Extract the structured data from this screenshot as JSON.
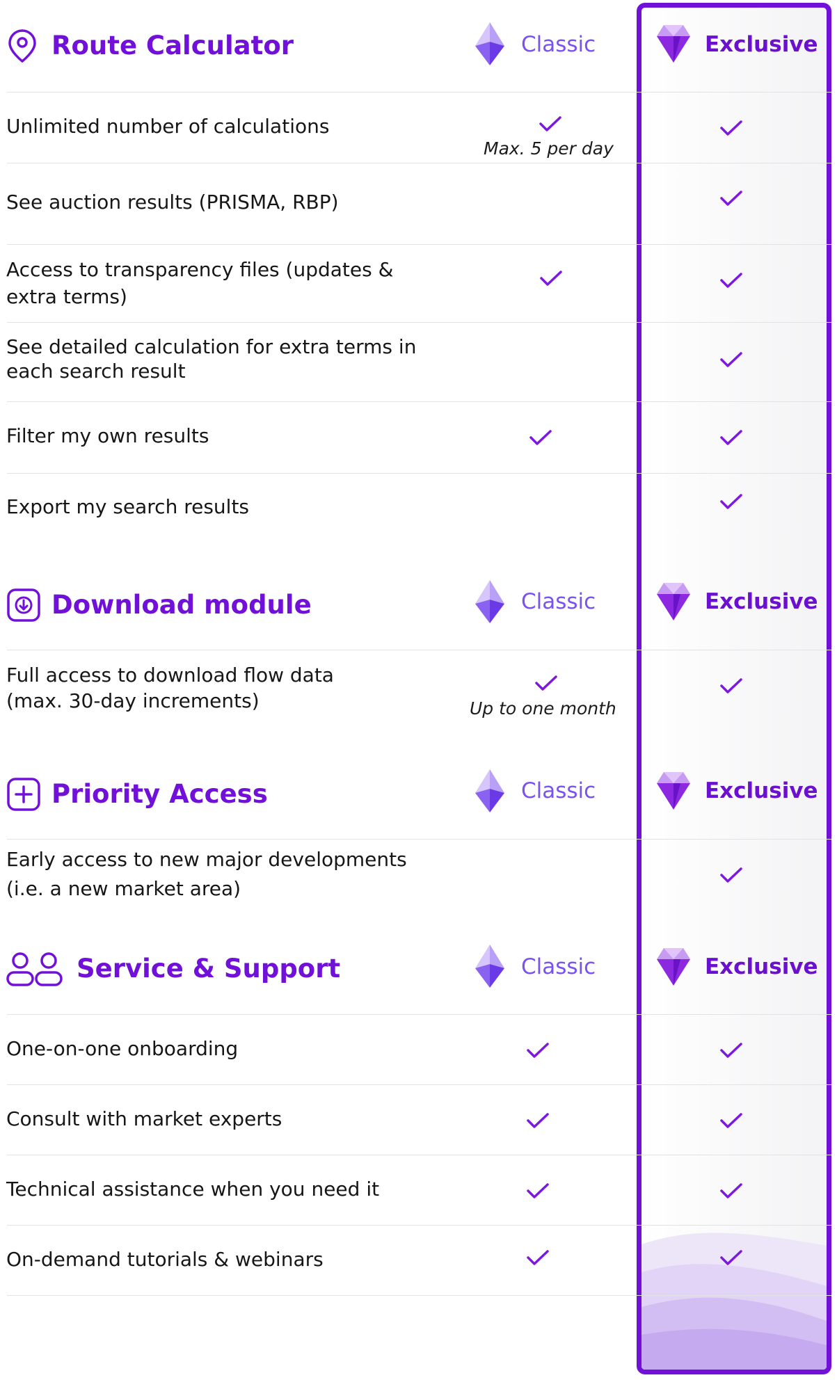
{
  "tier_labels": {
    "classic": "Classic",
    "exclusive": "Exclusive"
  },
  "colors": {
    "accent": "#7110d8",
    "classic": "#7a52f0",
    "check": "#7d18e0",
    "divider": "#e2e2e2"
  },
  "sections": [
    {
      "title": "Route Calculator",
      "icon": "location-pin-icon",
      "features": [
        {
          "label": "Unlimited number of calculations",
          "classic": true,
          "classic_note": "Max. 5 per day",
          "exclusive": true
        },
        {
          "label": "See auction results (PRISMA, RBP)",
          "classic": false,
          "exclusive": true
        },
        {
          "label_lines": [
            "Access to transparency files (updates &",
            "extra terms)"
          ],
          "classic": true,
          "exclusive": true
        },
        {
          "label_lines": [
            "See detailed calculation for extra terms in",
            "each search result"
          ],
          "classic": false,
          "exclusive": true
        },
        {
          "label": "Filter my own results",
          "classic": true,
          "exclusive": true
        },
        {
          "label": "Export my search results",
          "classic": false,
          "exclusive": true
        }
      ]
    },
    {
      "title": "Download module",
      "icon": "download-icon",
      "features": [
        {
          "label_lines": [
            "Full access to download flow data",
            "(max. 30-day increments)"
          ],
          "classic": true,
          "classic_note": "Up to one month",
          "exclusive": true
        }
      ]
    },
    {
      "title": "Priority Access",
      "icon": "plus-square-icon",
      "features": [
        {
          "label_lines": [
            "Early access to new major developments",
            "(i.e. a new market area)"
          ],
          "classic": false,
          "exclusive": true
        }
      ]
    },
    {
      "title": "Service & Support",
      "icon": "people-icon",
      "features": [
        {
          "label": "One-on-one onboarding",
          "classic": true,
          "exclusive": true
        },
        {
          "label": "Consult with market experts",
          "classic": true,
          "exclusive": true
        },
        {
          "label": "Technical assistance when you need it",
          "classic": true,
          "exclusive": true
        },
        {
          "label": "On-demand tutorials & webinars",
          "classic": true,
          "exclusive": true
        }
      ]
    }
  ]
}
